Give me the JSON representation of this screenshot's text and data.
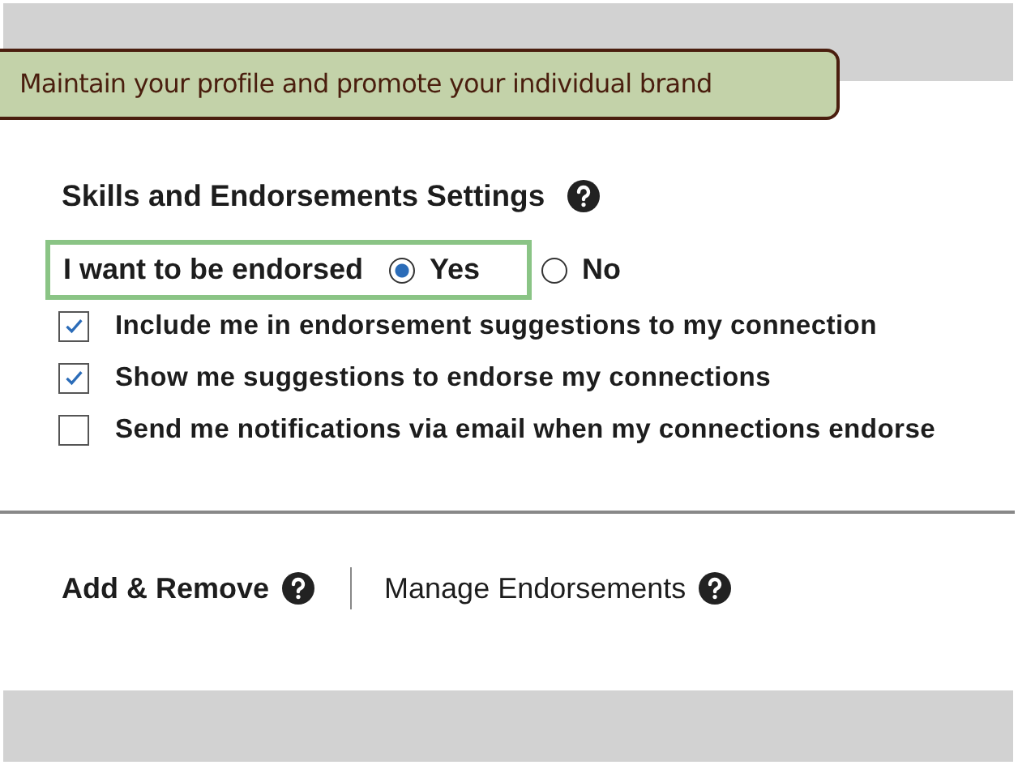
{
  "banner": {
    "text": "Maintain your profile and promote your individual brand"
  },
  "section": {
    "title": "Skills and Endorsements Settings"
  },
  "endorse": {
    "label": "I want to be endorsed",
    "options": [
      {
        "label": "Yes",
        "selected": true
      },
      {
        "label": "No",
        "selected": false
      }
    ]
  },
  "checkboxes": [
    {
      "label": "Include me in endorsement suggestions to my connection",
      "checked": true
    },
    {
      "label": "Show me suggestions to endorse my connections",
      "checked": true
    },
    {
      "label": "Send me notifications via email when my connections endorse",
      "checked": false
    }
  ],
  "tabs": [
    {
      "label": "Add & Remove",
      "selected": true
    },
    {
      "label": "Manage Endorsements",
      "selected": false
    }
  ]
}
